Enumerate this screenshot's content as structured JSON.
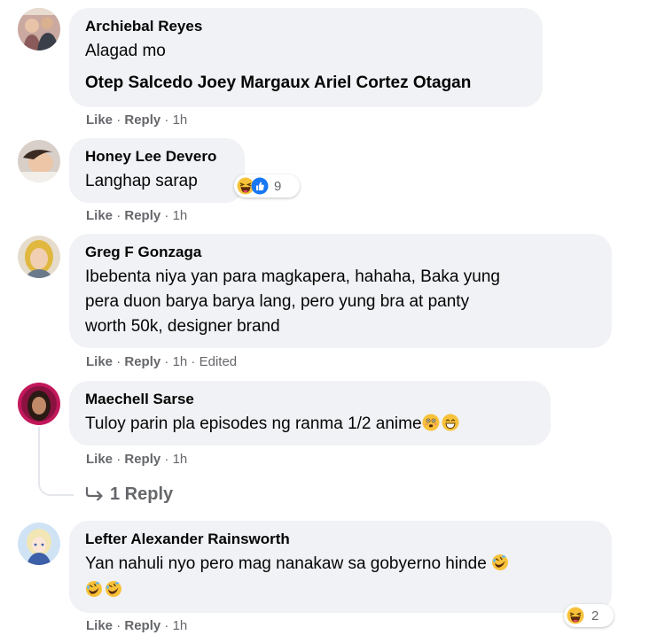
{
  "comments": [
    {
      "author": "Archiebal Reyes",
      "text": "Alagad mo",
      "tags": "Otep Salcedo Joey Margaux Ariel Cortez Otagan",
      "like": "Like",
      "reply": "Reply",
      "sep": "·",
      "time": "1h"
    },
    {
      "author": "Honey Lee Devero",
      "text": "Langhap sarap",
      "like": "Like",
      "reply": "Reply",
      "sep": "·",
      "time": "1h",
      "reaction_count": "9",
      "reaction_icons": [
        "haha-icon",
        "like-icon"
      ]
    },
    {
      "author": "Greg F Gonzaga",
      "lines": [
        "Ibebenta niya yan para magkapera, hahaha, Baka yung",
        "pera duon barya barya lang, pero yung bra at panty",
        "worth 50k, designer brand"
      ],
      "like": "Like",
      "reply": "Reply",
      "sep": "·",
      "time": "1h",
      "edited": "Edited"
    },
    {
      "author": "Maechell Sarse",
      "text": "Tuloy parin pla episodes ng ranma 1/2 anime",
      "like": "Like",
      "reply": "Reply",
      "sep": "·",
      "time": "1h",
      "replies_label": "1 Reply"
    },
    {
      "author": "Lefter Alexander Rainsworth",
      "text": "Yan nahuli nyo pero mag nanakaw sa gobyerno hinde",
      "like": "Like",
      "reply": "Reply",
      "sep": "·",
      "time": "1h",
      "reaction_count": "2",
      "reaction_icons": [
        "haha-icon"
      ]
    }
  ],
  "colors": {
    "bubble": "#f0f2f5",
    "meta": "#65676b",
    "like_blue": "#1877f2",
    "haha_yellow": "#f7b125"
  }
}
